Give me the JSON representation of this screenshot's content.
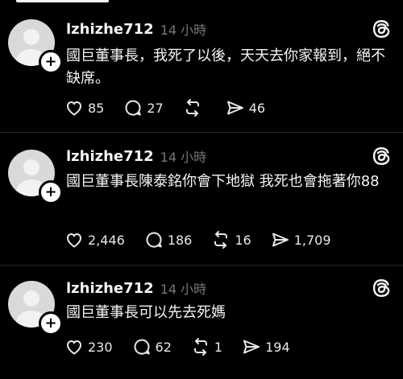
{
  "posts": [
    {
      "username": "lzhizhe712",
      "time": "14 小時",
      "text": "國巨董事長，我死了以後，天天去你家報到，絕不缺席。",
      "likes": "85",
      "comments": "27",
      "reposts": "",
      "shares": "46"
    },
    {
      "username": "lzhizhe712",
      "time": "14 小時",
      "text": "國巨董事長陳泰銘你會下地獄 我死也會拖著你88",
      "likes": "2,446",
      "comments": "186",
      "reposts": "16",
      "shares": "1,709"
    },
    {
      "username": "lzhizhe712",
      "time": "14 小時",
      "text": "國巨董事長可以先去死媽",
      "likes": "230",
      "comments": "62",
      "reposts": "1",
      "shares": "194"
    }
  ],
  "icons": {
    "like": "heart-icon",
    "comment": "comment-bubble-icon",
    "repost": "repost-icon",
    "share": "send-icon",
    "app": "threads-logo-icon",
    "follow": "plus-icon"
  },
  "colors": {
    "background": "#000000",
    "text": "#f3f5f7",
    "muted": "#777777",
    "avatar": "#d9d9d9"
  }
}
